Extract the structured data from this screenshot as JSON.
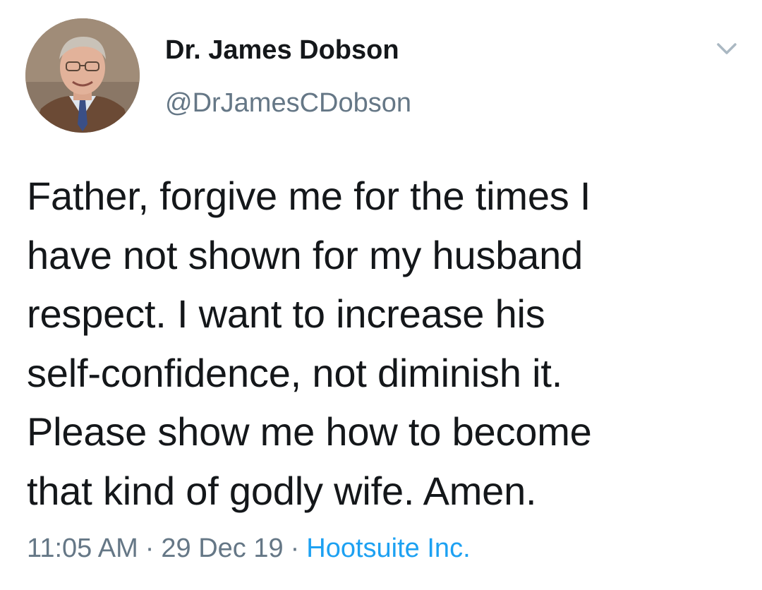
{
  "author": {
    "display_name": "Dr. James Dobson",
    "handle": "@DrJamesCDobson"
  },
  "tweet": {
    "lines": [
      "Father, forgive me for the times I",
      "have not shown for my husband",
      "respect. I want to increase his",
      "self-confidence, not diminish it.",
      "Please show me how to become",
      "that kind of godly wife. Amen."
    ]
  },
  "meta": {
    "time": "11:05 AM",
    "date": "29 Dec 19",
    "separator": "·",
    "source": "Hootsuite Inc."
  },
  "icons": {
    "menu": "chevron-down-icon",
    "avatar": "profile-photo"
  },
  "colors": {
    "text": "#14171a",
    "secondary": "#657786",
    "link": "#1da1f2",
    "chevron": "#aab8c2"
  }
}
